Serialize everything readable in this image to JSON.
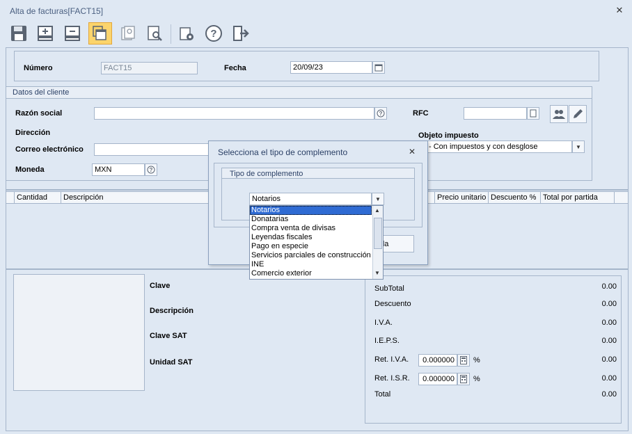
{
  "window": {
    "title": "Alta de facturas[FACT15]"
  },
  "toolbar": {
    "buttons": [
      {
        "icon": "save-icon"
      },
      {
        "icon": "add-row-icon"
      },
      {
        "icon": "remove-row-icon"
      },
      {
        "icon": "copy-documents-icon"
      },
      {
        "icon": "document-preview-icon"
      },
      {
        "icon": "search-document-icon"
      },
      {
        "icon": "settings-document-icon"
      },
      {
        "icon": "help-icon"
      },
      {
        "icon": "exit-icon"
      }
    ]
  },
  "header": {
    "numero_label": "Número",
    "numero_value": "FACT15",
    "fecha_label": "Fecha",
    "fecha_value": "20/09/23"
  },
  "client": {
    "section_title": "Datos del cliente",
    "razon_label": "Razón social",
    "razon_value": "",
    "rfc_label": "RFC",
    "rfc_value": "",
    "direccion_label": "Dirección",
    "objeto_label": "Objeto impuesto",
    "objeto_value": "- Con impuestos y con desglose",
    "correo_label": "Correo electrónico",
    "correo_value": "",
    "moneda_label": "Moneda",
    "moneda_value": "MXN"
  },
  "grid": {
    "columns": [
      "Cantidad",
      "Descripción",
      "Precio unitario",
      "Descuento %",
      "Total por partida"
    ]
  },
  "product": {
    "clave_label": "Clave",
    "descripcion_label": "Descripción",
    "clave_sat_label": "Clave SAT",
    "unidad_sat_label": "Unidad SAT"
  },
  "totals": {
    "subtotal_label": "SubTotal",
    "subtotal_value": "0.00",
    "descuento_label": "Descuento",
    "descuento_value": "0.00",
    "iva_label": "I.V.A.",
    "iva_value": "0.00",
    "ieps_label": "I.E.P.S.",
    "ieps_value": "0.00",
    "ret_iva_label": "Ret. I.V.A.",
    "ret_iva_rate": "0.000000",
    "ret_iva_pct": "%",
    "ret_iva_value": "0.00",
    "ret_isr_label": "Ret. I.S.R.",
    "ret_isr_rate": "0.000000",
    "ret_isr_pct": "%",
    "ret_isr_value": "0.00",
    "total_label": "Total",
    "total_value": "0.00"
  },
  "dialog": {
    "title": "Selecciona el tipo de complemento",
    "group_title": "Tipo de complemento",
    "selected_value": "Notarios",
    "options": [
      "Notarios",
      "Donatarias",
      "Compra venta de divisas",
      "Leyendas fiscales",
      "Pago en especie",
      "Servicios parciales de construcción",
      "INE",
      "Comercio exterior"
    ],
    "help_button_partial": "uda"
  },
  "colors": {
    "background": "#dfe8f3",
    "border": "#a5b5ca",
    "active_toolbar": "#fbd46c",
    "selection": "#2f6bd3"
  }
}
